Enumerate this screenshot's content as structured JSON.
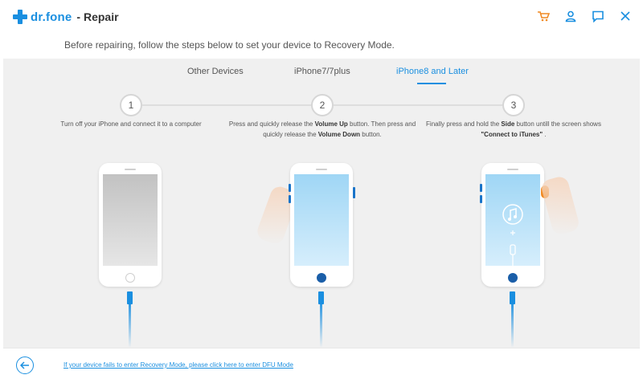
{
  "titlebar": {
    "brand": "dr.fone",
    "app_name": "- Repair",
    "icons": [
      "cart-icon",
      "user-icon",
      "feedback-icon",
      "close-icon"
    ],
    "accent": "#1a8fe0",
    "cart_color": "#f08a24"
  },
  "instruction": "Before repairing, follow the steps below to set your device to Recovery Mode.",
  "tabs": [
    {
      "label": "Other Devices",
      "active": false
    },
    {
      "label": "iPhone7/7plus",
      "active": false
    },
    {
      "label": "iPhone8 and Later",
      "active": true
    }
  ],
  "steps": [
    {
      "number": "1",
      "text": "Turn off your iPhone and connect it to a computer"
    },
    {
      "number": "2",
      "text_a": "Press and quickly release the ",
      "bold_a": "Volume Up",
      "text_b": " button. Then press and quickly release the ",
      "bold_b": "Volume Down",
      "text_c": " button."
    },
    {
      "number": "3",
      "text_a": "Finally press and hold the ",
      "bold_a": "Side",
      "text_b": " button untill the screen shows ",
      "bold_b": "\"Connect to iTunes\"",
      "text_c": " ."
    }
  ],
  "footer": {
    "dfu_link": "If your device fails to enter Recovery Mode, please click here to enter DFU Mode"
  }
}
